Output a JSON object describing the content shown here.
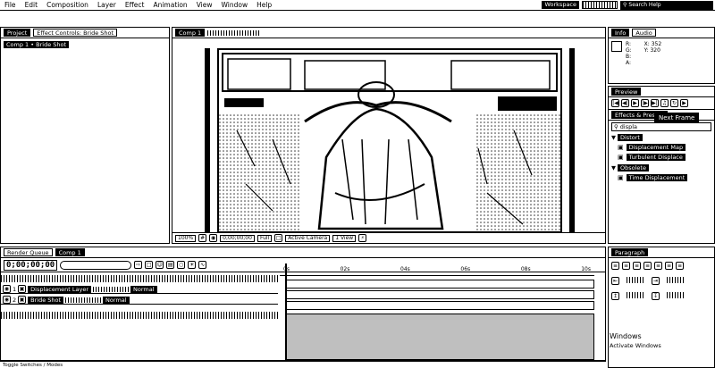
{
  "menu": [
    "File",
    "Edit",
    "Composition",
    "Layer",
    "Effect",
    "Animation",
    "View",
    "Window",
    "Help"
  ],
  "workspace": {
    "label": "Workspace",
    "value": ""
  },
  "search": {
    "placeholder": "Search Help"
  },
  "project": {
    "tabs": [
      "Project",
      "Effect Controls: Bride Shot"
    ],
    "comp_path": "Comp 1 • Bride Shot"
  },
  "composition": {
    "tabs": [
      "Comp 1"
    ],
    "viewer_fields": [
      "100%",
      "0;00;00;00",
      "Full",
      "Active Camera",
      "1 View"
    ]
  },
  "info": {
    "tabs": [
      "Info",
      "Audio"
    ],
    "values": [
      "R:",
      "G:",
      "B:",
      "A:",
      "X: 352",
      "Y: 320"
    ]
  },
  "effects": {
    "tabs": [
      "Preview",
      "Effects & Presets"
    ],
    "search_value": "displa",
    "categories": [
      {
        "name": "Distort",
        "items": [
          "Displacement Map",
          "Turbulent Displace"
        ]
      },
      {
        "name": "Obsolete",
        "items": [
          "Time Displacement"
        ]
      }
    ]
  },
  "tooltip": "Next Frame",
  "paragraph": {
    "tabs": [
      "Paragraph"
    ]
  },
  "timeline": {
    "tabs": [
      "Render Queue",
      "Comp 1"
    ],
    "timecode": "0;00;00;00",
    "ruler_marks": [
      "0s",
      "02s",
      "04s",
      "06s",
      "08s",
      "10s"
    ],
    "layers": [
      {
        "num": "1",
        "name": "Displacement Layer",
        "mode": "Normal"
      },
      {
        "num": "2",
        "name": "Bride Shot",
        "mode": "Normal"
      }
    ]
  },
  "status": {
    "left": "Toggle Switches / Modes"
  },
  "watermark": {
    "line1": "Windows",
    "line2": "Activate Windows"
  }
}
